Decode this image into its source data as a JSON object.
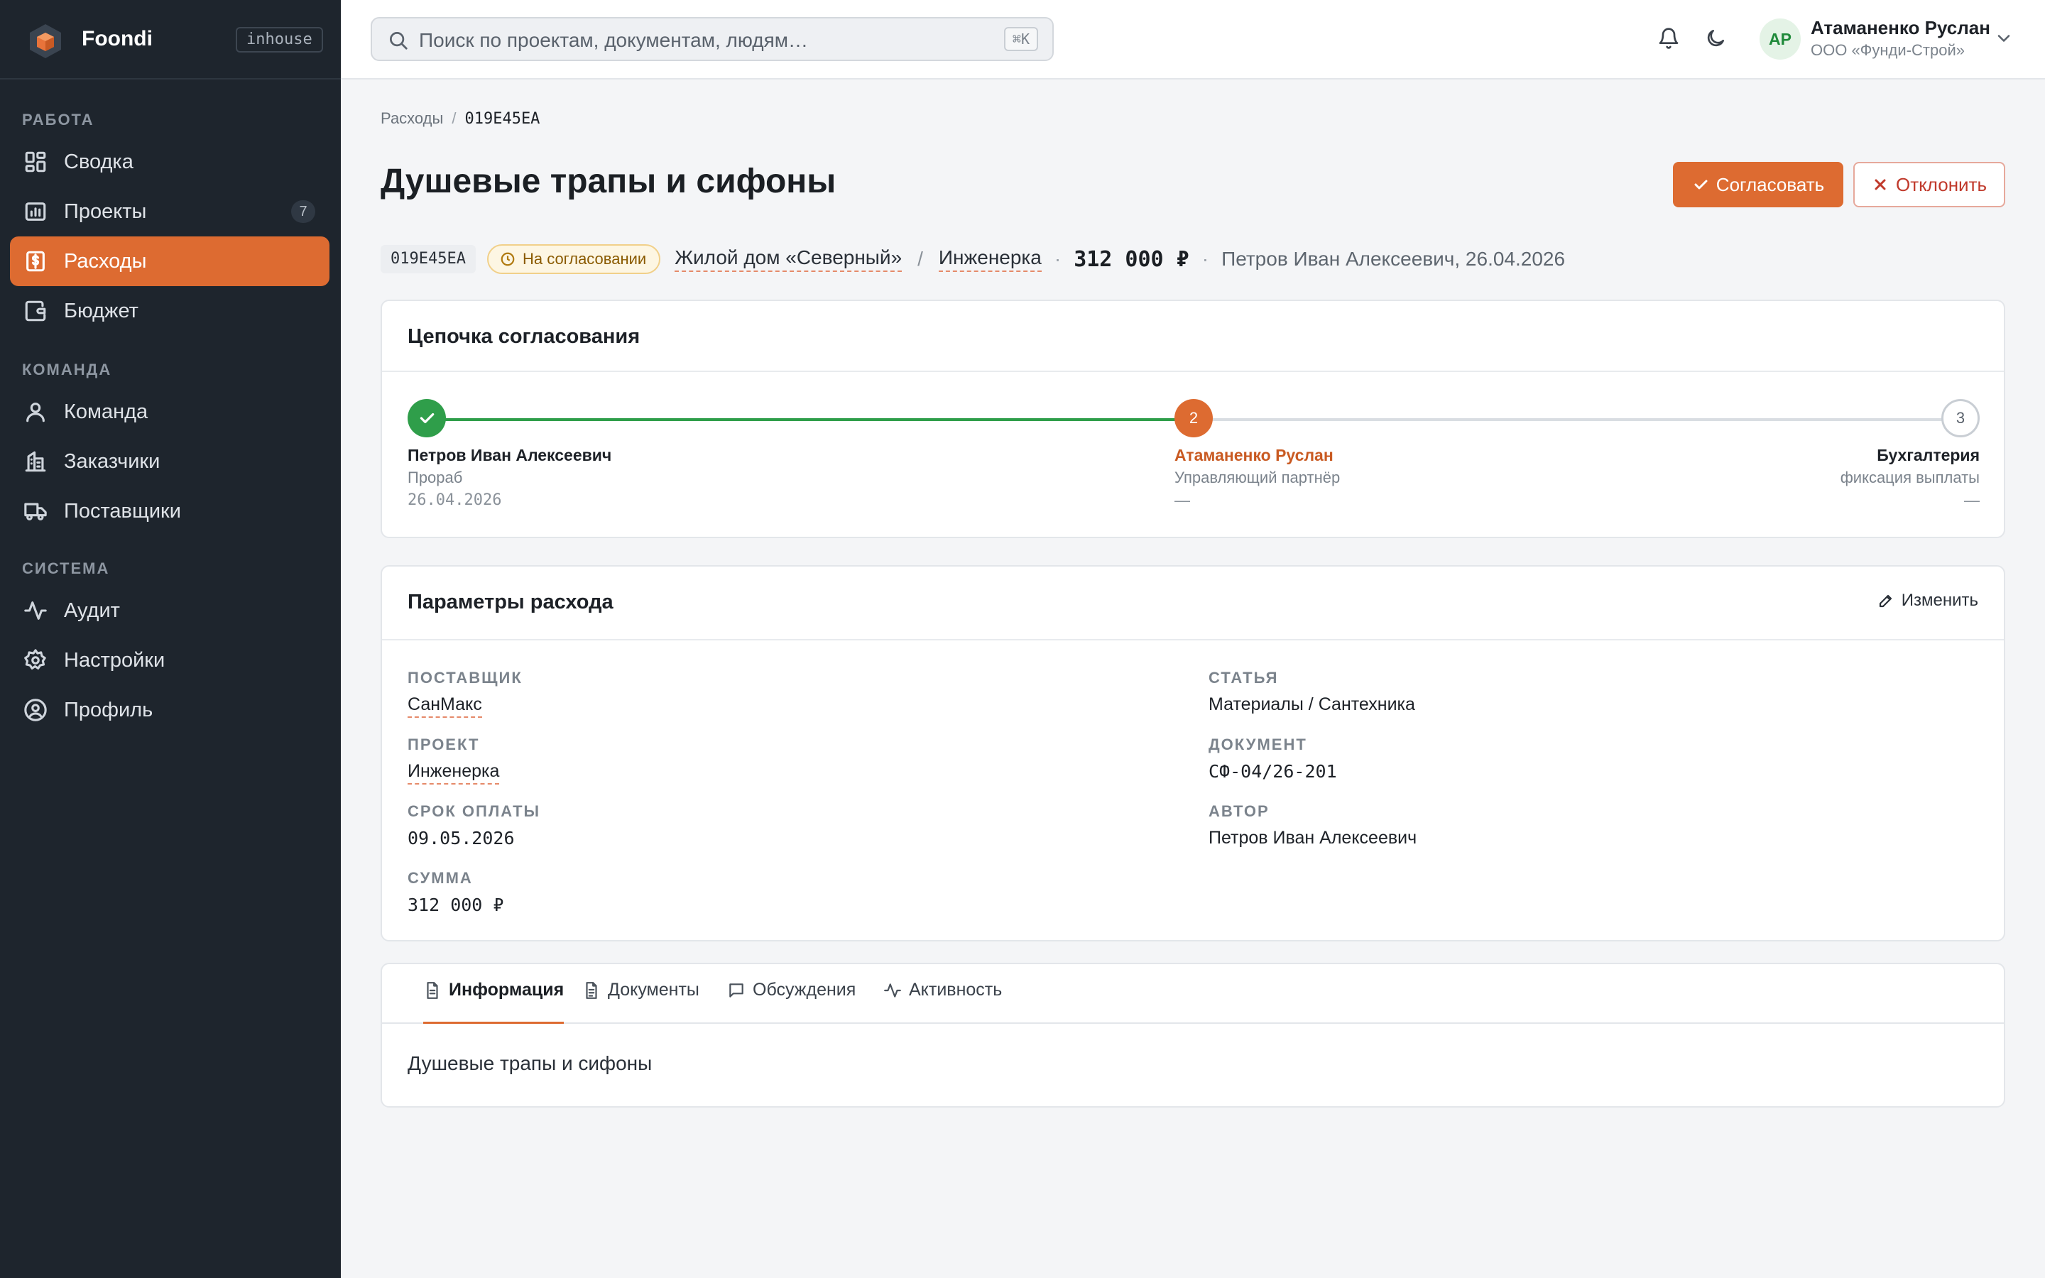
{
  "app": {
    "name": "Foondi",
    "badge": "inhouse"
  },
  "sidebar": {
    "sections": [
      {
        "title": "РАБОТА"
      },
      {
        "title": "КОМАНДА"
      },
      {
        "title": "СИСТЕМА"
      }
    ],
    "items": [
      {
        "label": "Сводка",
        "icon": "dashboard-icon"
      },
      {
        "label": "Проекты",
        "icon": "chart-icon",
        "count": "7"
      },
      {
        "label": "Расходы",
        "icon": "expense-icon",
        "active": true
      },
      {
        "label": "Бюджет",
        "icon": "wallet-icon"
      },
      {
        "label": "Команда",
        "icon": "user-icon"
      },
      {
        "label": "Заказчики",
        "icon": "building-icon"
      },
      {
        "label": "Поставщики",
        "icon": "truck-icon"
      },
      {
        "label": "Аудит",
        "icon": "activity-icon"
      },
      {
        "label": "Настройки",
        "icon": "gear-icon"
      },
      {
        "label": "Профиль",
        "icon": "profile-icon"
      }
    ],
    "active_color": "#dd6b31"
  },
  "topbar": {
    "search_placeholder": "Поиск по проектам, документам, людям…",
    "search_shortcut": "⌘K",
    "user": {
      "initials": "АР",
      "name": "Атаманенко Руслан",
      "org": "ООО «Фунди-Строй»"
    }
  },
  "breadcrumb": {
    "parent": "Расходы",
    "current": "019E45EA"
  },
  "page": {
    "title": "Душевые трапы и сифоны",
    "approve_label": "Согласовать",
    "reject_label": "Отклонить"
  },
  "meta": {
    "id": "019E45EA",
    "status": "На согласовании",
    "object": "Жилой дом «Северный»",
    "project": "Инженерка",
    "amount": "312 000 ₽",
    "author": "Петров Иван Алексеевич, 26.04.2026"
  },
  "chain": {
    "title": "Цепочка согласования",
    "steps": [
      {
        "marker": "✓",
        "name": "Петров Иван Алексеевич",
        "role": "Прораб",
        "date": "26.04.2026",
        "state": "done"
      },
      {
        "marker": "2",
        "name": "Атаманенко Руслан",
        "role": "Управляющий партнёр",
        "date": "—",
        "state": "current"
      },
      {
        "marker": "3",
        "name": "Бухгалтерия",
        "role": "фиксация выплаты",
        "date": "—",
        "state": "pending"
      }
    ],
    "colors": {
      "done": "#2f9e4a",
      "current": "#dd6b31",
      "pending": "#c9ced4"
    }
  },
  "params": {
    "title": "Параметры расхода",
    "edit_label": "Изменить",
    "fields": {
      "supplier": {
        "label": "ПОСТАВЩИК",
        "value": "СанМакс"
      },
      "project": {
        "label": "ПРОЕКТ",
        "value": "Инженерка"
      },
      "due": {
        "label": "СРОК ОПЛАТЫ",
        "value": "09.05.2026"
      },
      "sum": {
        "label": "СУММА",
        "value": "312 000 ₽"
      },
      "article": {
        "label": "СТАТЬЯ",
        "value": "Материалы / Сантехника"
      },
      "document": {
        "label": "ДОКУМЕНТ",
        "value": "СФ-04/26-201"
      },
      "author": {
        "label": "АВТОР",
        "value": "Петров Иван Алексеевич"
      }
    }
  },
  "tabs": {
    "items": [
      {
        "label": "Информация",
        "icon": "document-icon",
        "active": true
      },
      {
        "label": "Документы",
        "icon": "file-icon"
      },
      {
        "label": "Обсуждения",
        "icon": "chat-icon"
      },
      {
        "label": "Активность",
        "icon": "activity-icon"
      }
    ],
    "content": "Душевые трапы и сифоны"
  }
}
